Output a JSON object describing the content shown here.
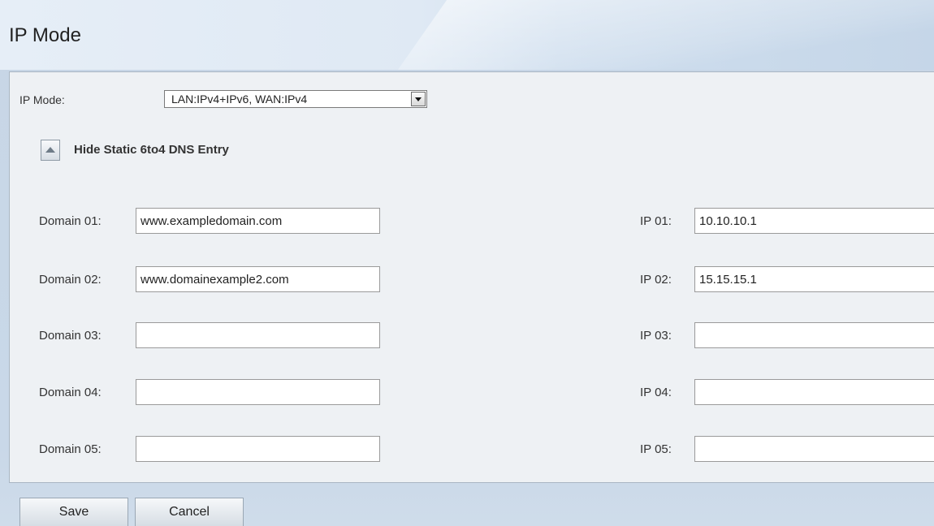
{
  "page": {
    "title": "IP Mode"
  },
  "ip_mode": {
    "label": "IP Mode:",
    "selected": "LAN:IPv4+IPv6, WAN:IPv4"
  },
  "toggle": {
    "label": "Hide Static 6to4 DNS Entry"
  },
  "entries": [
    {
      "domain_label": "Domain 01:",
      "domain_value": "www.exampledomain.com",
      "ip_label": "IP 01:",
      "ip_value": "10.10.10.1"
    },
    {
      "domain_label": "Domain 02:",
      "domain_value": "www.domainexample2.com",
      "ip_label": "IP 02:",
      "ip_value": "15.15.15.1"
    },
    {
      "domain_label": "Domain 03:",
      "domain_value": "",
      "ip_label": "IP 03:",
      "ip_value": ""
    },
    {
      "domain_label": "Domain 04:",
      "domain_value": "",
      "ip_label": "IP 04:",
      "ip_value": ""
    },
    {
      "domain_label": "Domain 05:",
      "domain_value": "",
      "ip_label": "IP 05:",
      "ip_value": ""
    }
  ],
  "buttons": {
    "save": "Save",
    "cancel": "Cancel"
  }
}
